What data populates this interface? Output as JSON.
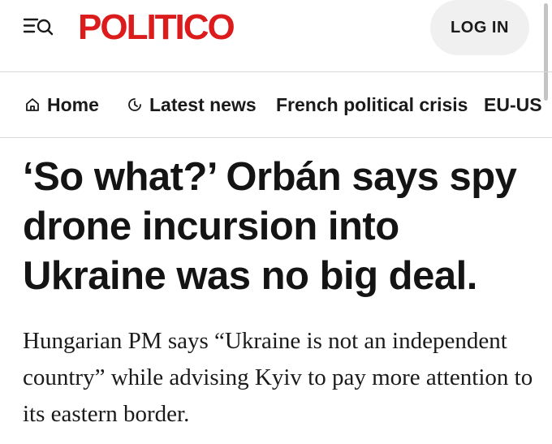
{
  "header": {
    "logo_text": "POLITICO",
    "login_label": "LOG IN",
    "menu_icon": "menu-search-icon"
  },
  "nav": {
    "items": [
      {
        "label": "Home",
        "icon": "home-icon"
      },
      {
        "label": "Latest news",
        "icon": "clock-icon"
      },
      {
        "label": "French political crisis"
      },
      {
        "label": "EU-US"
      }
    ]
  },
  "article": {
    "headline": "‘So what?’ Orbán says spy drone incursion into Ukraine was no big deal.",
    "dek": "Hungarian PM says “Ukraine is not an independent country” while advising Kyiv to pay more attention to its eastern border."
  },
  "colors": {
    "brand": "#dc1c1c",
    "text": "#141414",
    "login_bg": "#f0f0f0",
    "divider": "#d8d8d8"
  }
}
